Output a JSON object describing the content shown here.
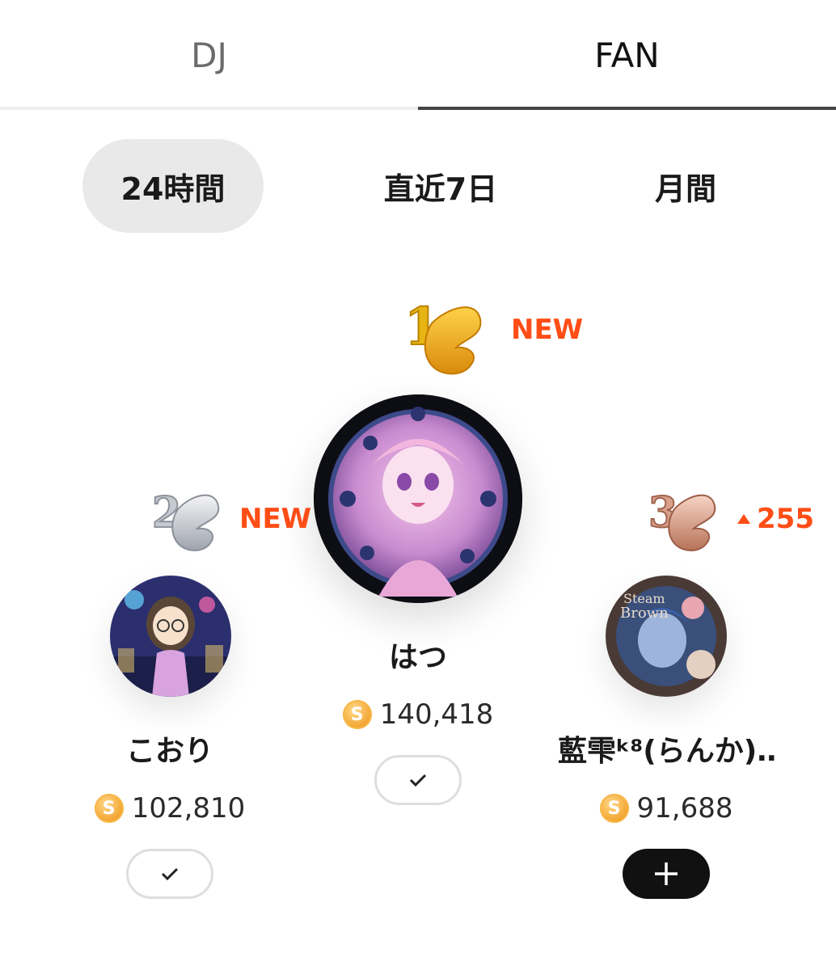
{
  "tabs": {
    "dj": "DJ",
    "fan": "FAN"
  },
  "periods": {
    "p24h": "24時間",
    "p7d": "直近7日",
    "month": "月間"
  },
  "ranking": {
    "first": {
      "rank": "1",
      "name": "はつ",
      "score": "140,418",
      "status": "NEW",
      "coin": "S"
    },
    "second": {
      "rank": "2",
      "name": "こおり",
      "score": "102,810",
      "status": "NEW",
      "coin": "S"
    },
    "third": {
      "rank": "3",
      "name": "藍雫ʚ̴̶̷̤ ꒳ ̫ ʚ̴̶̷̤ (らんか)…",
      "name_display": "藍雫ᵏ⁸(らんか)…",
      "score": "91,688",
      "change": "255",
      "coin": "S"
    }
  },
  "colors": {
    "accent": "#ff4d16",
    "active_tab_bg": "#e9e9e9",
    "coin": "#f2a22b"
  }
}
